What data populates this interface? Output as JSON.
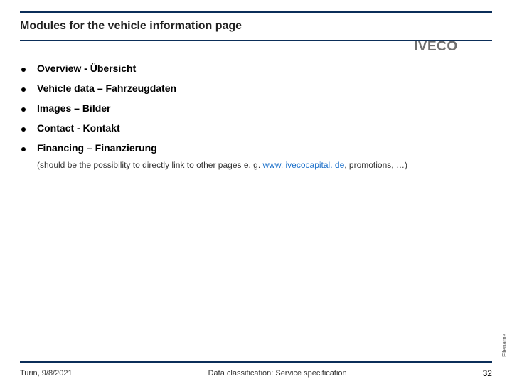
{
  "title": "Modules for the vehicle information page",
  "logo_text": "IVECO",
  "bullets": [
    {
      "text": "Overview - Übersicht"
    },
    {
      "text": "Vehicle data – Fahrzeugdaten"
    },
    {
      "text": "Images – Bilder"
    },
    {
      "text": "Contact - Kontakt"
    },
    {
      "text": "Financing – Finanzierung"
    }
  ],
  "sub_note_prefix": "(should be the possibility to directly link to other pages e. g. ",
  "sub_note_link": "www. ivecocapital. de",
  "sub_note_suffix": ", promotions, …)",
  "side_label": "Filename",
  "footer": {
    "left": "Turin, 9/8/2021",
    "center": "Data classification: Service specification",
    "page": "32"
  }
}
